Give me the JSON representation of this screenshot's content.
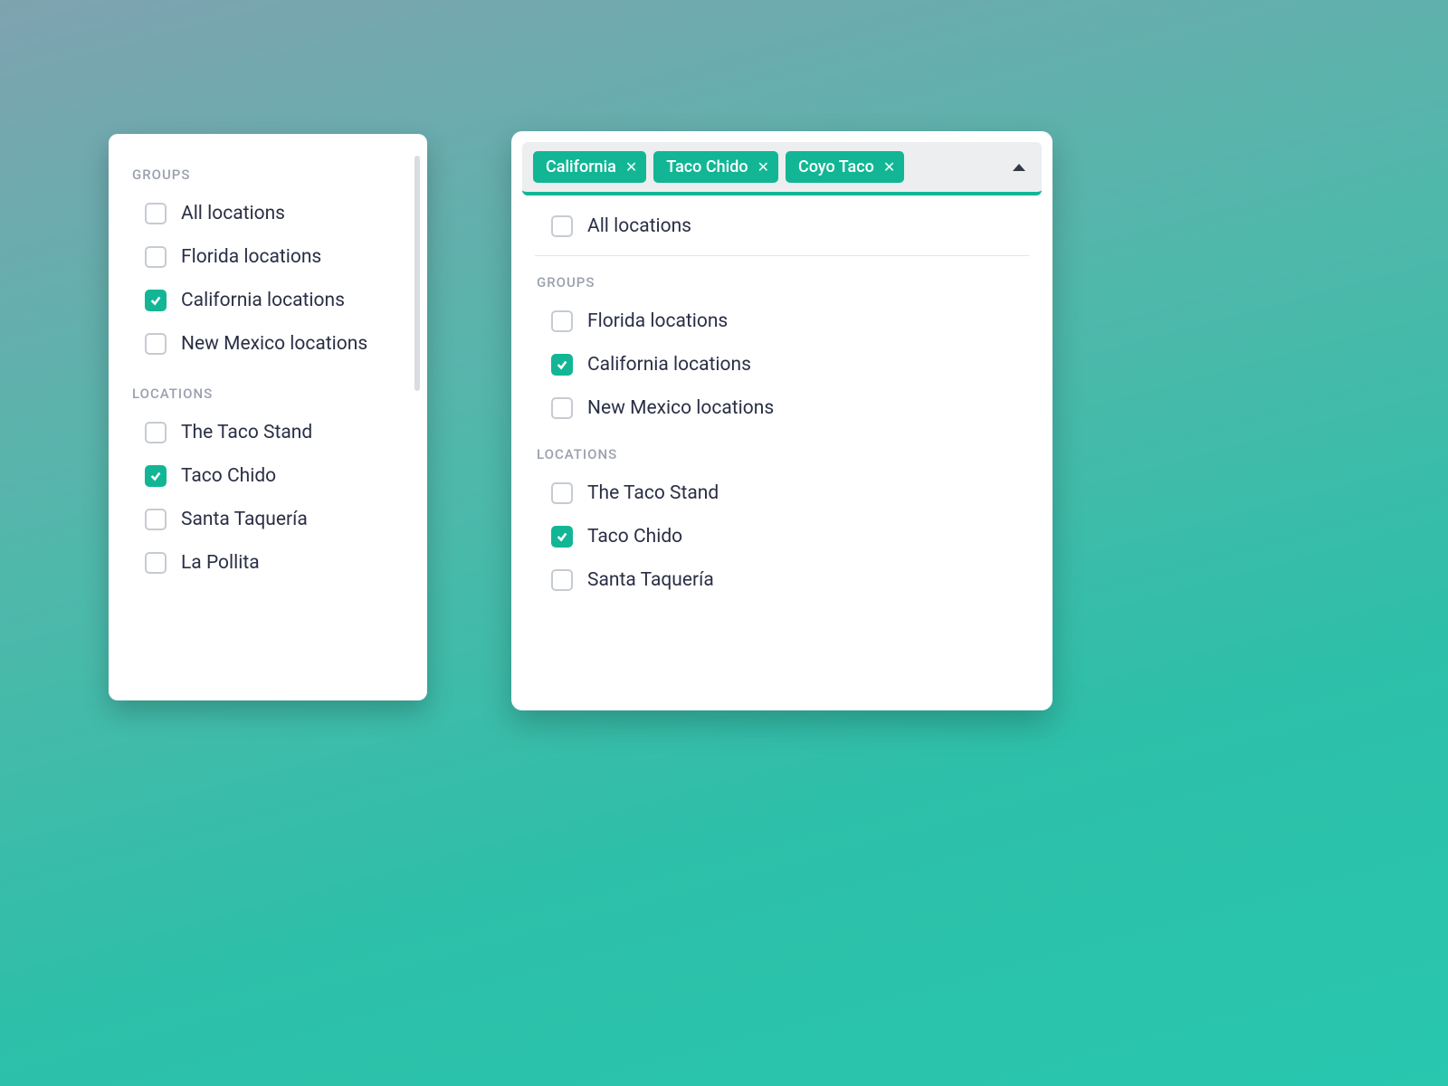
{
  "colors": {
    "accent": "#12b695"
  },
  "left": {
    "sections": [
      {
        "header": "GROUPS",
        "items": [
          {
            "label": "All locations",
            "checked": false
          },
          {
            "label": "Florida locations",
            "checked": false
          },
          {
            "label": "California locations",
            "checked": true
          },
          {
            "label": "New Mexico locations",
            "checked": false
          }
        ]
      },
      {
        "header": "LOCATIONS",
        "items": [
          {
            "label": "The Taco Stand",
            "checked": false
          },
          {
            "label": "Taco Chido",
            "checked": true
          },
          {
            "label": "Santa Taquería",
            "checked": false
          },
          {
            "label": "La Pollita",
            "checked": false
          }
        ]
      }
    ]
  },
  "right": {
    "chips": [
      {
        "label": "California"
      },
      {
        "label": "Taco Chido"
      },
      {
        "label": "Coyo Taco"
      }
    ],
    "top_item": {
      "label": "All locations",
      "checked": false
    },
    "sections": [
      {
        "header": "GROUPS",
        "items": [
          {
            "label": "Florida locations",
            "checked": false
          },
          {
            "label": "California locations",
            "checked": true
          },
          {
            "label": "New Mexico locations",
            "checked": false
          }
        ]
      },
      {
        "header": "LOCATIONS",
        "items": [
          {
            "label": "The Taco Stand",
            "checked": false
          },
          {
            "label": "Taco Chido",
            "checked": true
          },
          {
            "label": "Santa Taquería",
            "checked": false
          }
        ]
      }
    ]
  }
}
